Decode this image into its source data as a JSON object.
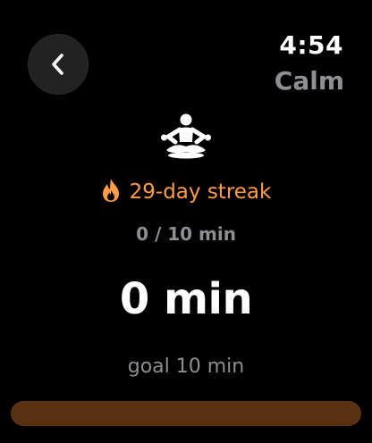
{
  "header": {
    "time": "4:54",
    "app_title": "Calm",
    "back_icon": "chevron-left-icon"
  },
  "session": {
    "icon": "meditation-icon",
    "streak_icon": "flame-icon",
    "streak_text": "29-day streak",
    "progress_text": "0 / 10 min",
    "minutes_display": "0 min",
    "goal_text": "goal 10 min",
    "progress_fraction": 0.0
  },
  "colors": {
    "accent": "#ff9d47",
    "track": "#5a3211",
    "secondary_text": "#8e8e93",
    "background": "#000000"
  }
}
